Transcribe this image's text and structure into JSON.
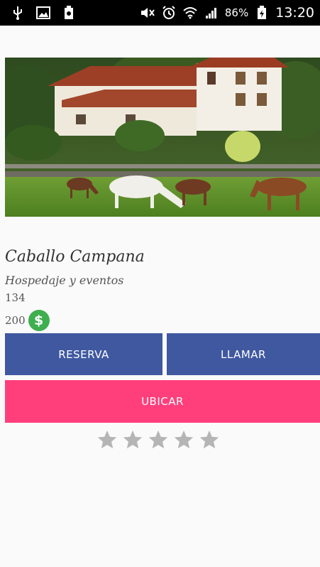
{
  "status_bar": {
    "battery_percent": "86%",
    "time": "13:20",
    "icons": [
      "usb-icon",
      "image-icon",
      "battery-saver-icon",
      "mute-icon",
      "alarm-icon",
      "wifi-icon",
      "signal-icon",
      "battery-charging-icon"
    ]
  },
  "place": {
    "name": "Caballo Campana",
    "category": "Hospedaje y eventos",
    "count": "134",
    "price": "200",
    "currency_symbol": "$"
  },
  "actions": {
    "reserva_label": "RESERVA",
    "llamar_label": "LLAMAR",
    "ubicar_label": "UBICAR"
  },
  "rating": {
    "max": 5,
    "value": 0
  },
  "colors": {
    "primary_button": "#3f58a0",
    "accent_button": "#ff3f7b",
    "money_badge": "#3fae4f",
    "star_empty": "#b5b5b5"
  }
}
